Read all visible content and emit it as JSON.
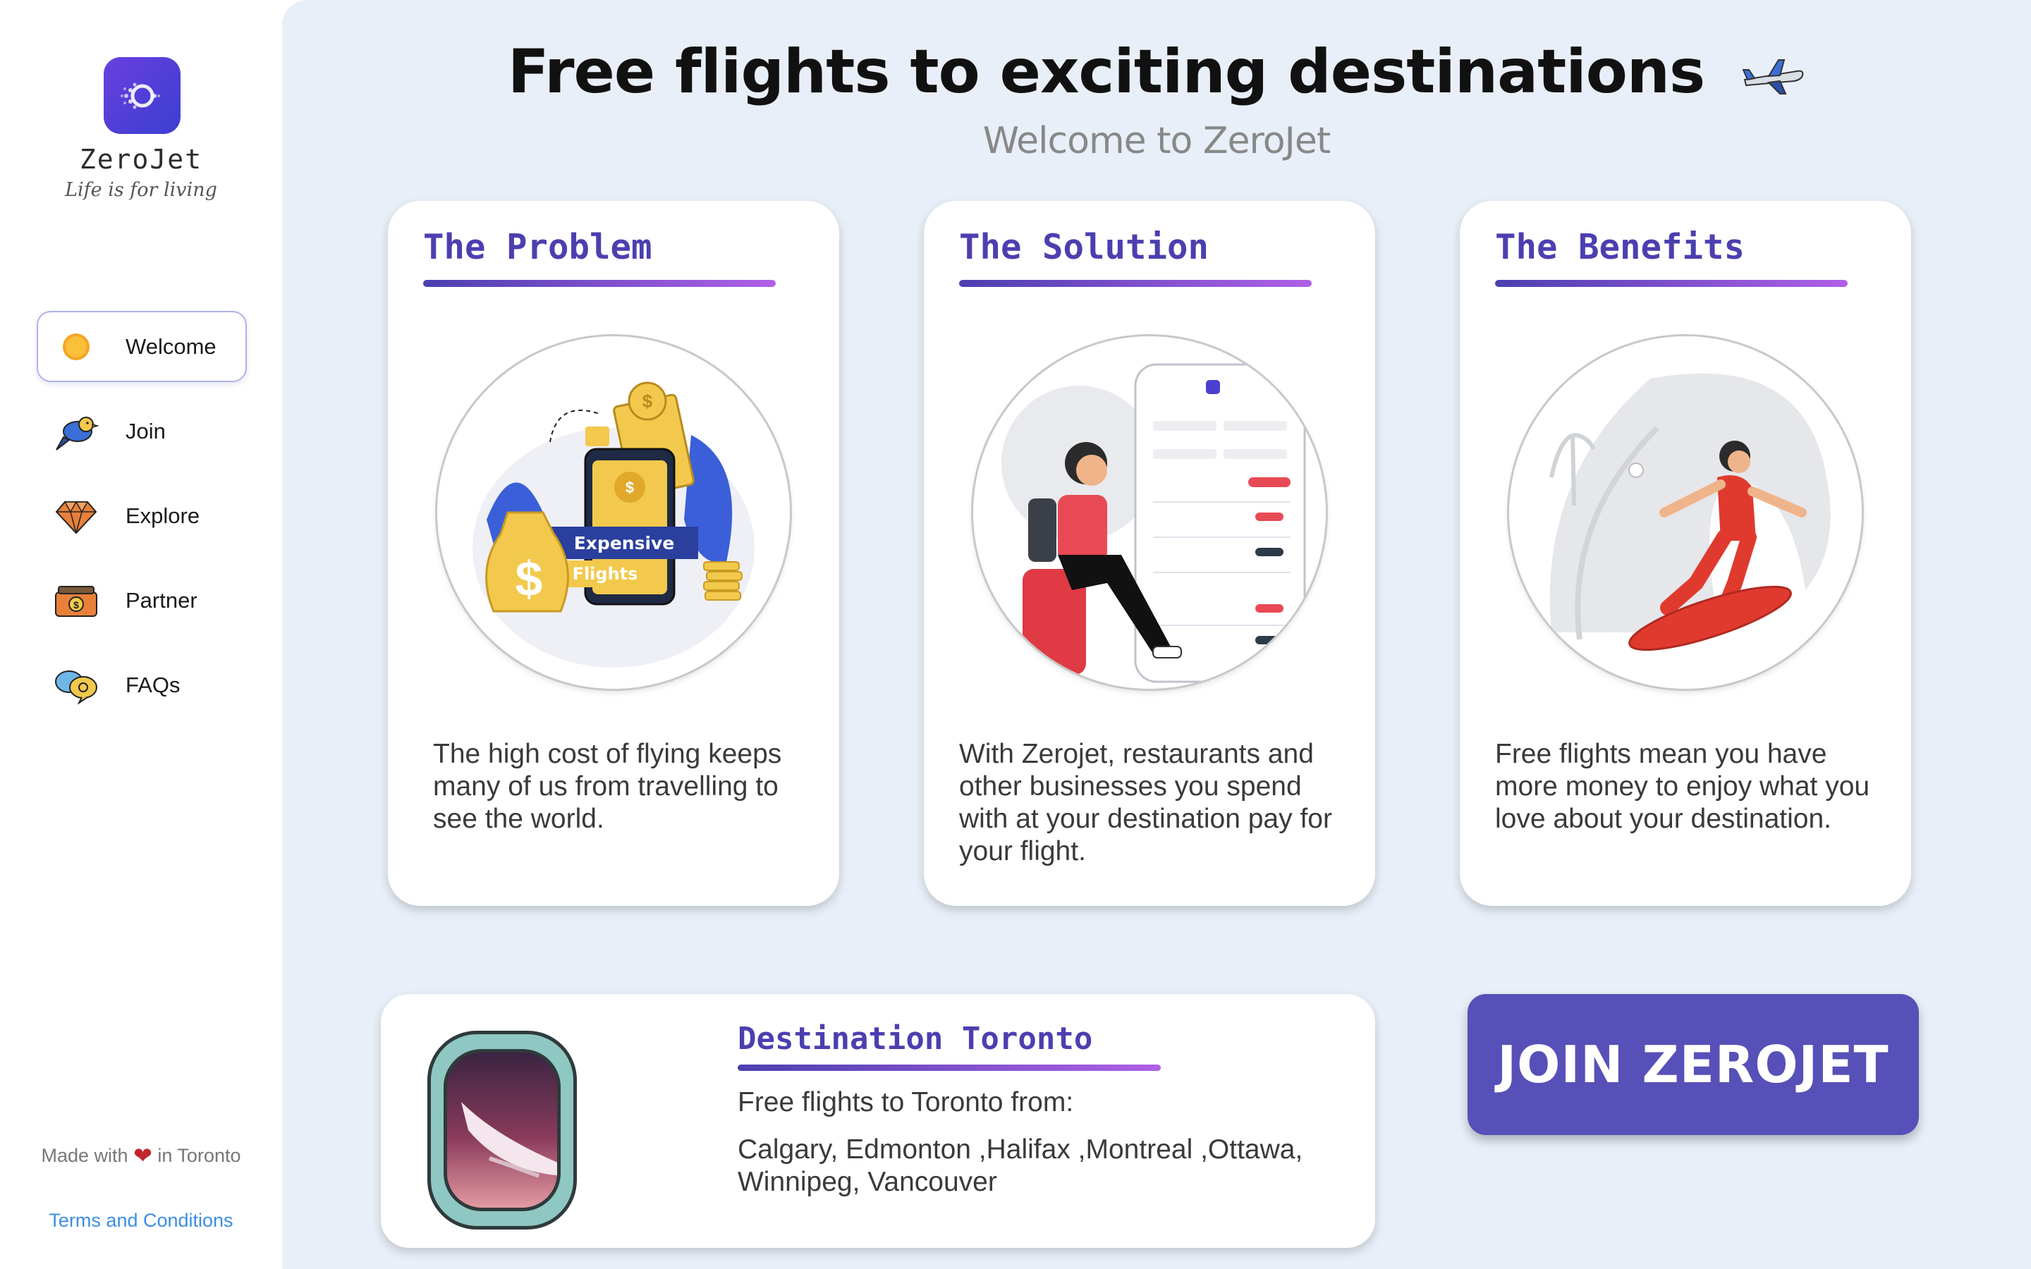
{
  "brand": {
    "name": "ZeroJet",
    "tagline": "Life is for living"
  },
  "nav": [
    {
      "label": "Welcome",
      "icon": "sun-icon",
      "active": true
    },
    {
      "label": "Join",
      "icon": "bird-icon",
      "active": false
    },
    {
      "label": "Explore",
      "icon": "diamond-icon",
      "active": false
    },
    {
      "label": "Partner",
      "icon": "money-icon",
      "active": false
    },
    {
      "label": "FAQs",
      "icon": "chat-bubbles-icon",
      "active": false
    }
  ],
  "footer": {
    "made_with_prefix": "Made with",
    "made_with_suffix": "in Toronto",
    "terms": "Terms and Conditions"
  },
  "header": {
    "title": "Free flights to exciting destinations",
    "subtitle": "Welcome to ZeroJet"
  },
  "cards": [
    {
      "title": "The Problem",
      "badge_line1": "Expensive",
      "badge_line2": "Flights",
      "body": "The high cost of flying keeps many of us from travelling to see the world."
    },
    {
      "title": "The Solution",
      "body": "With Zerojet, restaurants and other businesses you spend with at your destination pay for your flight."
    },
    {
      "title": "The Benefits",
      "body": "Free flights mean you have more money to enjoy what you love about your destination."
    }
  ],
  "destination": {
    "title": "Destination Toronto",
    "from_label": "Free flights to Toronto from:",
    "cities": "Calgary, Edmonton ,Halifax ,Montreal ,Ottawa, Winnipeg, Vancouver"
  },
  "cta": {
    "label": "JOIN ZEROJET"
  },
  "colors": {
    "accent": "#4b3fb0",
    "cta": "#5750b8",
    "background": "#e9eff8",
    "link": "#3a8ee6"
  }
}
